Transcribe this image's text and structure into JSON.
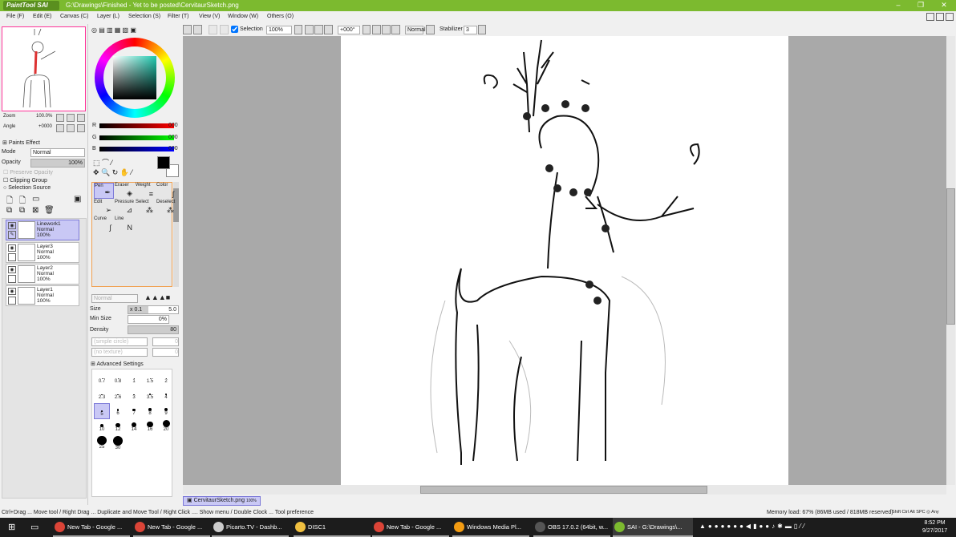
{
  "titlebar": {
    "app": "PaintTool SAI",
    "path": "G:\\Drawings\\Finished - Yet to be posted\\CervitaurSketch.png"
  },
  "menu": [
    "File (F)",
    "Edit (E)",
    "Canvas (C)",
    "Layer (L)",
    "Selection (S)",
    "Filter (T)",
    "View (V)",
    "Window (W)",
    "Others (O)"
  ],
  "toolbar": {
    "selection_label": "Selection",
    "selection_checked": true,
    "zoom": "100%",
    "rotation": "+000°",
    "mode": "Normal",
    "stabilizer_label": "Stabilizer",
    "stabilizer": "3"
  },
  "navigator": {
    "zoom_label": "Zoom",
    "zoom": "100.0%",
    "angle_label": "Angle",
    "angle": "+0000"
  },
  "paint_effect": {
    "header": "Paints Effect",
    "mode_label": "Mode",
    "mode": "Normal",
    "opacity_label": "Opacity",
    "opacity": "100%",
    "preserve_opacity": "Preserve Opacity",
    "clipping_group": "Clipping Group",
    "selection_source": "Selection Source"
  },
  "layers": [
    {
      "name": "Linework1",
      "mode": "Normal",
      "opacity": "100%",
      "selected": true
    },
    {
      "name": "Layer3",
      "mode": "Normal",
      "opacity": "100%",
      "selected": false
    },
    {
      "name": "Layer2",
      "mode": "Normal",
      "opacity": "100%",
      "selected": false
    },
    {
      "name": "Layer1",
      "mode": "Normal",
      "opacity": "100%",
      "selected": false
    }
  ],
  "color": {
    "r_label": "R",
    "g_label": "G",
    "b_label": "B",
    "r": "000",
    "g": "000",
    "b": "000",
    "primary": "#000000",
    "secondary": "#ffffff"
  },
  "tools": [
    {
      "label": "Pen",
      "icon": "pen-icon",
      "glyph": "✒"
    },
    {
      "label": "Eraser",
      "icon": "eraser-icon",
      "glyph": "◈"
    },
    {
      "label": "Weight",
      "icon": "weight-icon",
      "glyph": "≡"
    },
    {
      "label": "Color",
      "icon": "color-icon",
      "glyph": "ʃ"
    },
    {
      "label": "Edit",
      "icon": "edit-icon",
      "glyph": "➢"
    },
    {
      "label": "Pressure",
      "icon": "pressure-icon",
      "glyph": "⊿"
    },
    {
      "label": "Select",
      "icon": "select-icon",
      "glyph": "⁂"
    },
    {
      "label": "Deselect",
      "icon": "deselect-icon",
      "glyph": "⁂"
    },
    {
      "label": "Curve",
      "icon": "curve-icon",
      "glyph": "∫"
    },
    {
      "label": "Line",
      "icon": "line-icon",
      "glyph": "N"
    }
  ],
  "brush": {
    "blend": "Normal",
    "size_label": "Size",
    "size_mult": "x 0.1",
    "size": "5.0",
    "min_size_label": "Min Size",
    "min_size": "0%",
    "density_label": "Density",
    "density": "80",
    "shape": "(simple circle)",
    "shape_val": "0",
    "texture": "(no texture)",
    "texture_val": "0",
    "advanced": "Advanced Settings"
  },
  "brush_sizes": [
    "0.7",
    "0.8",
    "1",
    "1.5",
    "2",
    "2.3",
    "2.6",
    "3",
    "3.5",
    "4",
    "5",
    "6",
    "7",
    "8",
    "9",
    "10",
    "12",
    "14",
    "16",
    "20",
    "25",
    "30"
  ],
  "selected_brush_size": "5",
  "document_tab": {
    "name": "CervitaurSketch.png",
    "zoom": "100%"
  },
  "status": {
    "hint": "Ctrl+Drag ... Move tool / Right Drag ... Duplicate and Move Tool / Right Click .... Show menu / Double Clock ... Tool preference",
    "memory": "Memory load: 67% (86MB used / 818MB reserved)",
    "keys": [
      "Shift",
      "Ctrl",
      "Alt",
      "SPC",
      "Any"
    ]
  },
  "taskbar": {
    "tasks": [
      {
        "label": "New Tab - Google ...",
        "color": "#db4437"
      },
      {
        "label": "New Tab - Google ...",
        "color": "#db4437"
      },
      {
        "label": "Picarto.TV - Dashb...",
        "color": "#ccc"
      },
      {
        "label": "DISC1",
        "color": "#f0c040"
      },
      {
        "label": "New Tab - Google ...",
        "color": "#db4437"
      },
      {
        "label": "Windows Media Pl...",
        "color": "#f39c12"
      },
      {
        "label": "OBS 17.0.2 (64bit, w...",
        "color": "#555"
      },
      {
        "label": "SAI - G:\\Drawings\\...",
        "color": "#7cba2f"
      }
    ],
    "time": "8:52 PM",
    "date": "9/27/2017"
  }
}
